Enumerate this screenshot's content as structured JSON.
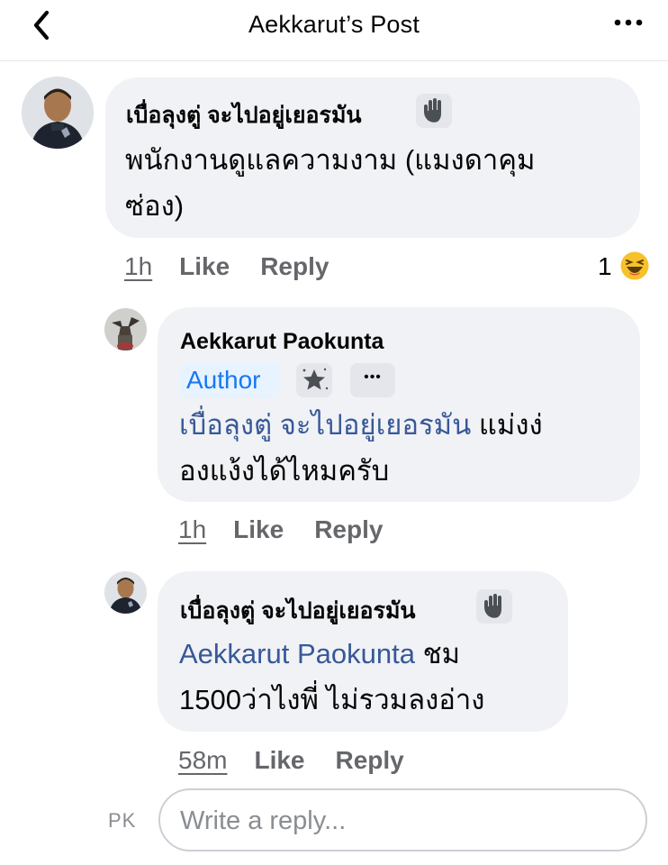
{
  "header": {
    "title": "Aekkarut’s Post",
    "back_icon": "chevron-left-icon",
    "more_icon": "more-horizontal-icon"
  },
  "comments": [
    {
      "author": "เบื่อลุงตู่ จะไปอยู่เยอรมัน",
      "badge_icon": "waving-hand-icon",
      "text_line1": "พนักงานดูแลความงาม (แมงดาคุม",
      "text_line2": "ซ่อง)",
      "time": "1h",
      "like": "Like",
      "reply": "Reply",
      "reaction_count": "1",
      "reaction_icon": "laughing-emoji-icon"
    },
    {
      "author": "Aekkarut Paokunta",
      "author_badge": "Author",
      "badge_icon": "star-icon",
      "more_label": "•••",
      "mention": "เบื่อลุงตู่ จะไปอยู่เยอรมัน",
      "text_line1_rest": " แม่งง่",
      "text_line2": "องแง้งได้ไหมครับ",
      "time": "1h",
      "like": "Like",
      "reply": "Reply"
    },
    {
      "author": "เบื่อลุงตู่ จะไปอยู่เยอรมัน",
      "badge_icon": "waving-hand-icon",
      "mention": "Aekkarut Paokunta",
      "text_line1_rest": " ชม",
      "text_line2": "1500ว่าไงพี่ ไม่รวมลงอ่าง",
      "time": "58m",
      "like": "Like",
      "reply": "Reply"
    }
  ],
  "composer": {
    "initials": "PK",
    "placeholder": "Write a reply..."
  },
  "colors": {
    "bubble": "#f0f2f5",
    "mention": "#385898",
    "meta": "#65676b",
    "author_badge_bg": "#e7f3ff",
    "author_badge_text": "#1877f2"
  }
}
